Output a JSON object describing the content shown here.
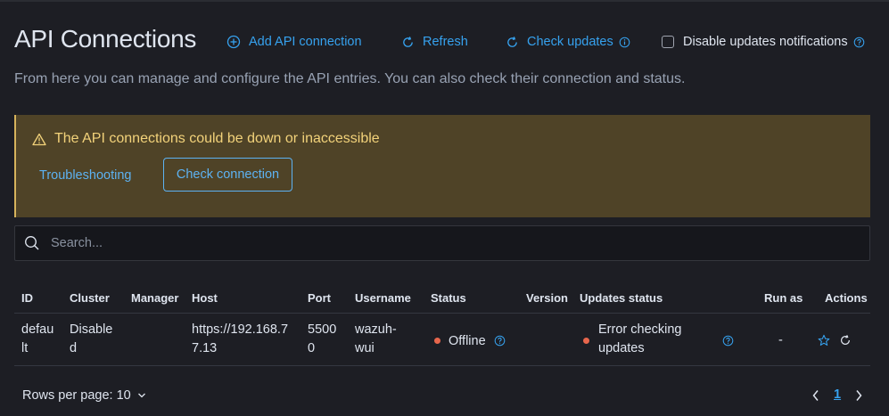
{
  "header": {
    "title": "API Connections",
    "add_label": "Add API connection",
    "refresh_label": "Refresh",
    "check_updates_label": "Check updates",
    "disable_notifications_label": "Disable updates notifications",
    "disable_notifications_checked": false
  },
  "subtitle": "From here you can manage and configure the API entries. You can also check their connection and status.",
  "callout": {
    "title": "The API connections could be down or inaccessible",
    "troubleshooting_label": "Troubleshooting",
    "check_connection_label": "Check connection"
  },
  "search": {
    "placeholder": "Search..."
  },
  "table": {
    "columns": [
      "ID",
      "Cluster",
      "Manager",
      "Host",
      "Port",
      "Username",
      "Status",
      "Version",
      "Updates status",
      "Run as",
      "Actions"
    ],
    "rows": [
      {
        "id": [
          "defau",
          "lt"
        ],
        "cluster": [
          "Disable",
          "d"
        ],
        "manager": "",
        "host": [
          "https://192.168.7",
          "7.13"
        ],
        "port": [
          "5500",
          "0"
        ],
        "username": [
          "wazuh-",
          "wui"
        ],
        "status": "Offline",
        "version": "",
        "updates_status": [
          "Error checking",
          "updates"
        ],
        "run_as": "-"
      }
    ]
  },
  "footer": {
    "rows_per_page_label": "Rows per page: 10",
    "current_page": "1"
  },
  "colors": {
    "accent": "#36a2ef",
    "warning_bg": "#4f4327",
    "warning_text": "#f2d27a",
    "status_danger": "#e7664c"
  }
}
